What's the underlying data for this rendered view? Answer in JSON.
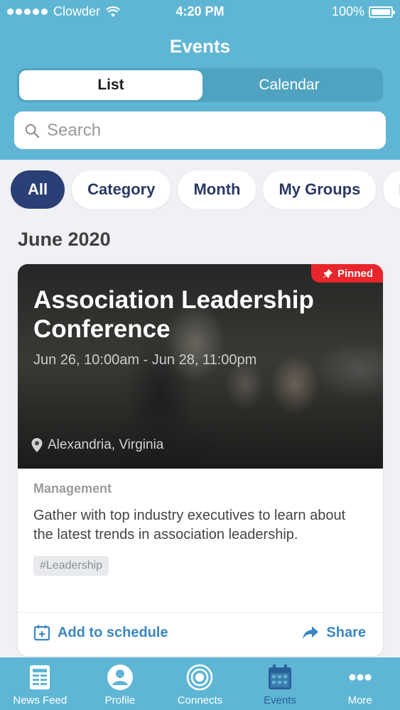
{
  "status_bar": {
    "carrier": "Clowder",
    "time": "4:20 PM",
    "battery": "100%"
  },
  "header": {
    "title": "Events",
    "segments": [
      {
        "label": "List",
        "selected": true
      },
      {
        "label": "Calendar",
        "selected": false
      }
    ],
    "search_placeholder": "Search"
  },
  "filters": {
    "chips": [
      "All",
      "Category",
      "Month",
      "My Groups",
      "P"
    ],
    "selected": "All"
  },
  "section": {
    "month": "June 2020"
  },
  "event": {
    "badge": "Pinned",
    "title": "Association Leadership Conference",
    "date": "Jun 26, 10:00am - Jun 28, 11:00pm",
    "location": "Alexandria, Virginia",
    "category": "Management",
    "description": "Gather with top industry executives to learn about the latest trends in association leadership.",
    "tag": "#Leadership",
    "add_label": "Add to schedule",
    "share_label": "Share"
  },
  "tabbar": {
    "items": [
      {
        "label": "News Feed",
        "icon": "news-feed-icon"
      },
      {
        "label": "Profile",
        "icon": "profile-icon"
      },
      {
        "label": "Connects",
        "icon": "connects-icon"
      },
      {
        "label": "Events",
        "icon": "calendar-icon",
        "active": true
      },
      {
        "label": "More",
        "icon": "more-icon"
      }
    ]
  },
  "colors": {
    "header": "#5fb6d4",
    "chip_active": "#2a3f75",
    "pinned": "#e8262c",
    "action": "#3b87c2",
    "tab_active": "#2a5f9c"
  }
}
